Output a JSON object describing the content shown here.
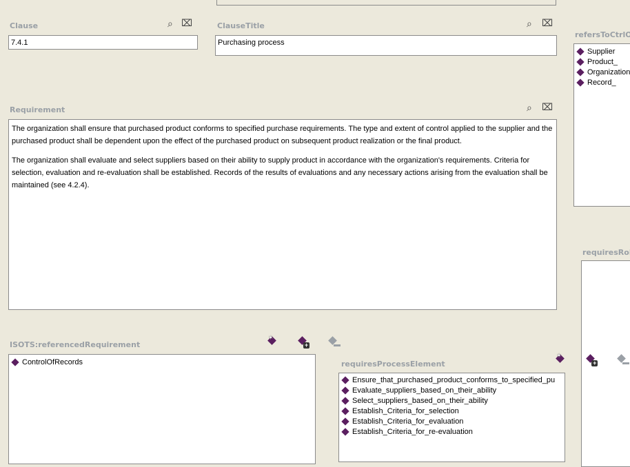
{
  "clause": {
    "label": "Clause",
    "value": "7.4.1"
  },
  "clause_title": {
    "label": "ClauseTitle",
    "value": "Purchasing process"
  },
  "refers_to_ctrl": {
    "label": "refersToCtrlO",
    "items": [
      "Supplier",
      "Product_",
      "Organization",
      "Record_"
    ]
  },
  "requirement": {
    "label": "Requirement",
    "paragraphs": [
      "The organization shall ensure that purchased product conforms to specified purchase requirements. The type and extent of control applied to the supplier and the purchased product shall be dependent upon the effect of the purchased product on subsequent product realization or the final product.",
      "The organization shall evaluate and select suppliers based on their ability to supply product in accordance with the organization's requirements. Criteria for selection, evaluation and re-evaluation shall be established. Records of the results of evaluations and any necessary actions arising from the evaluation shall be maintained (see 4.2.4)."
    ]
  },
  "requires_role": {
    "label": "requiresRol"
  },
  "referenced_requirement": {
    "label": "ISOTS:referencedRequirement",
    "items": [
      "ControlOfRecords"
    ]
  },
  "requires_process_element": {
    "label": "requiresProcessElement",
    "items": [
      "Ensure_that_purchased_product_conforms_to_specified_pu",
      "Evaluate_suppliers_based_on_their_ability",
      "Select_suppliers_based_on_their_ability",
      "Establish_Criteria_for_selection",
      "Establish_Criteria_for_evaluation",
      "Establish_Criteria_for_re-evaluation"
    ]
  },
  "icons": {
    "search": "search-icon",
    "delete": "delete-icon",
    "create_instance": "create-instance-icon",
    "add_instance": "add-instance-icon",
    "remove_instance": "remove-instance-icon"
  },
  "colors": {
    "background": "#ece9dc",
    "label": "#9aa0a6",
    "diamond": "#5b1f60"
  }
}
